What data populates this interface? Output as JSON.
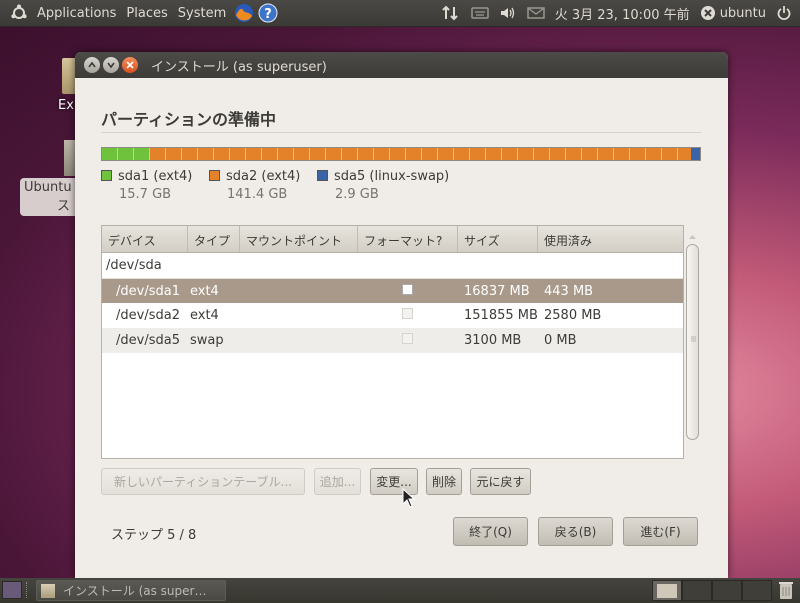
{
  "top_panel": {
    "menus": [
      "Applications",
      "Places",
      "System"
    ],
    "clock": "火 3月 23, 10:00 午前",
    "user": "ubuntu"
  },
  "desktop": {
    "icon1_label": "Ex",
    "icon2_label_line1": "Ubuntu",
    "icon2_label_line2": "ス"
  },
  "window": {
    "title": "インストール (as superuser)",
    "heading": "パーティションの準備中"
  },
  "partition_bar": {
    "segments": [
      {
        "color": "#6fc23b",
        "fraction": 0.0809
      },
      {
        "color": "#e4822a",
        "fraction": 0.9041
      },
      {
        "color": "#3a64a8",
        "fraction": 0.015
      }
    ]
  },
  "legend": [
    {
      "label": "sda1 (ext4)",
      "size": "15.7 GB",
      "color": "#6fc23b"
    },
    {
      "label": "sda2 (ext4)",
      "size": "141.4 GB",
      "color": "#e4822a"
    },
    {
      "label": "sda5 (linux-swap)",
      "size": "2.9 GB",
      "color": "#3a64a8"
    }
  ],
  "table": {
    "columns": [
      "デバイス",
      "タイプ",
      "マウントポイント",
      "フォーマット?",
      "サイズ",
      "使用済み"
    ],
    "disk": "/dev/sda",
    "rows": [
      {
        "device": "/dev/sda1",
        "type": "ext4",
        "mount": "",
        "size": "16837 MB",
        "used": "443 MB"
      },
      {
        "device": "/dev/sda2",
        "type": "ext4",
        "mount": "",
        "size": "151855 MB",
        "used": "2580 MB"
      },
      {
        "device": "/dev/sda5",
        "type": "swap",
        "mount": "",
        "size": "3100 MB",
        "used": "0 MB"
      }
    ]
  },
  "buttons": {
    "new_table": "新しいパーティションテーブル...",
    "add": "追加...",
    "change": "変更...",
    "delete": "削除",
    "revert": "元に戻す",
    "quit": "終了(Q)",
    "back": "戻る(B)",
    "forward": "進む(F)"
  },
  "step": "ステップ 5 / 8",
  "taskbar": {
    "task_label": "インストール (as super…"
  }
}
